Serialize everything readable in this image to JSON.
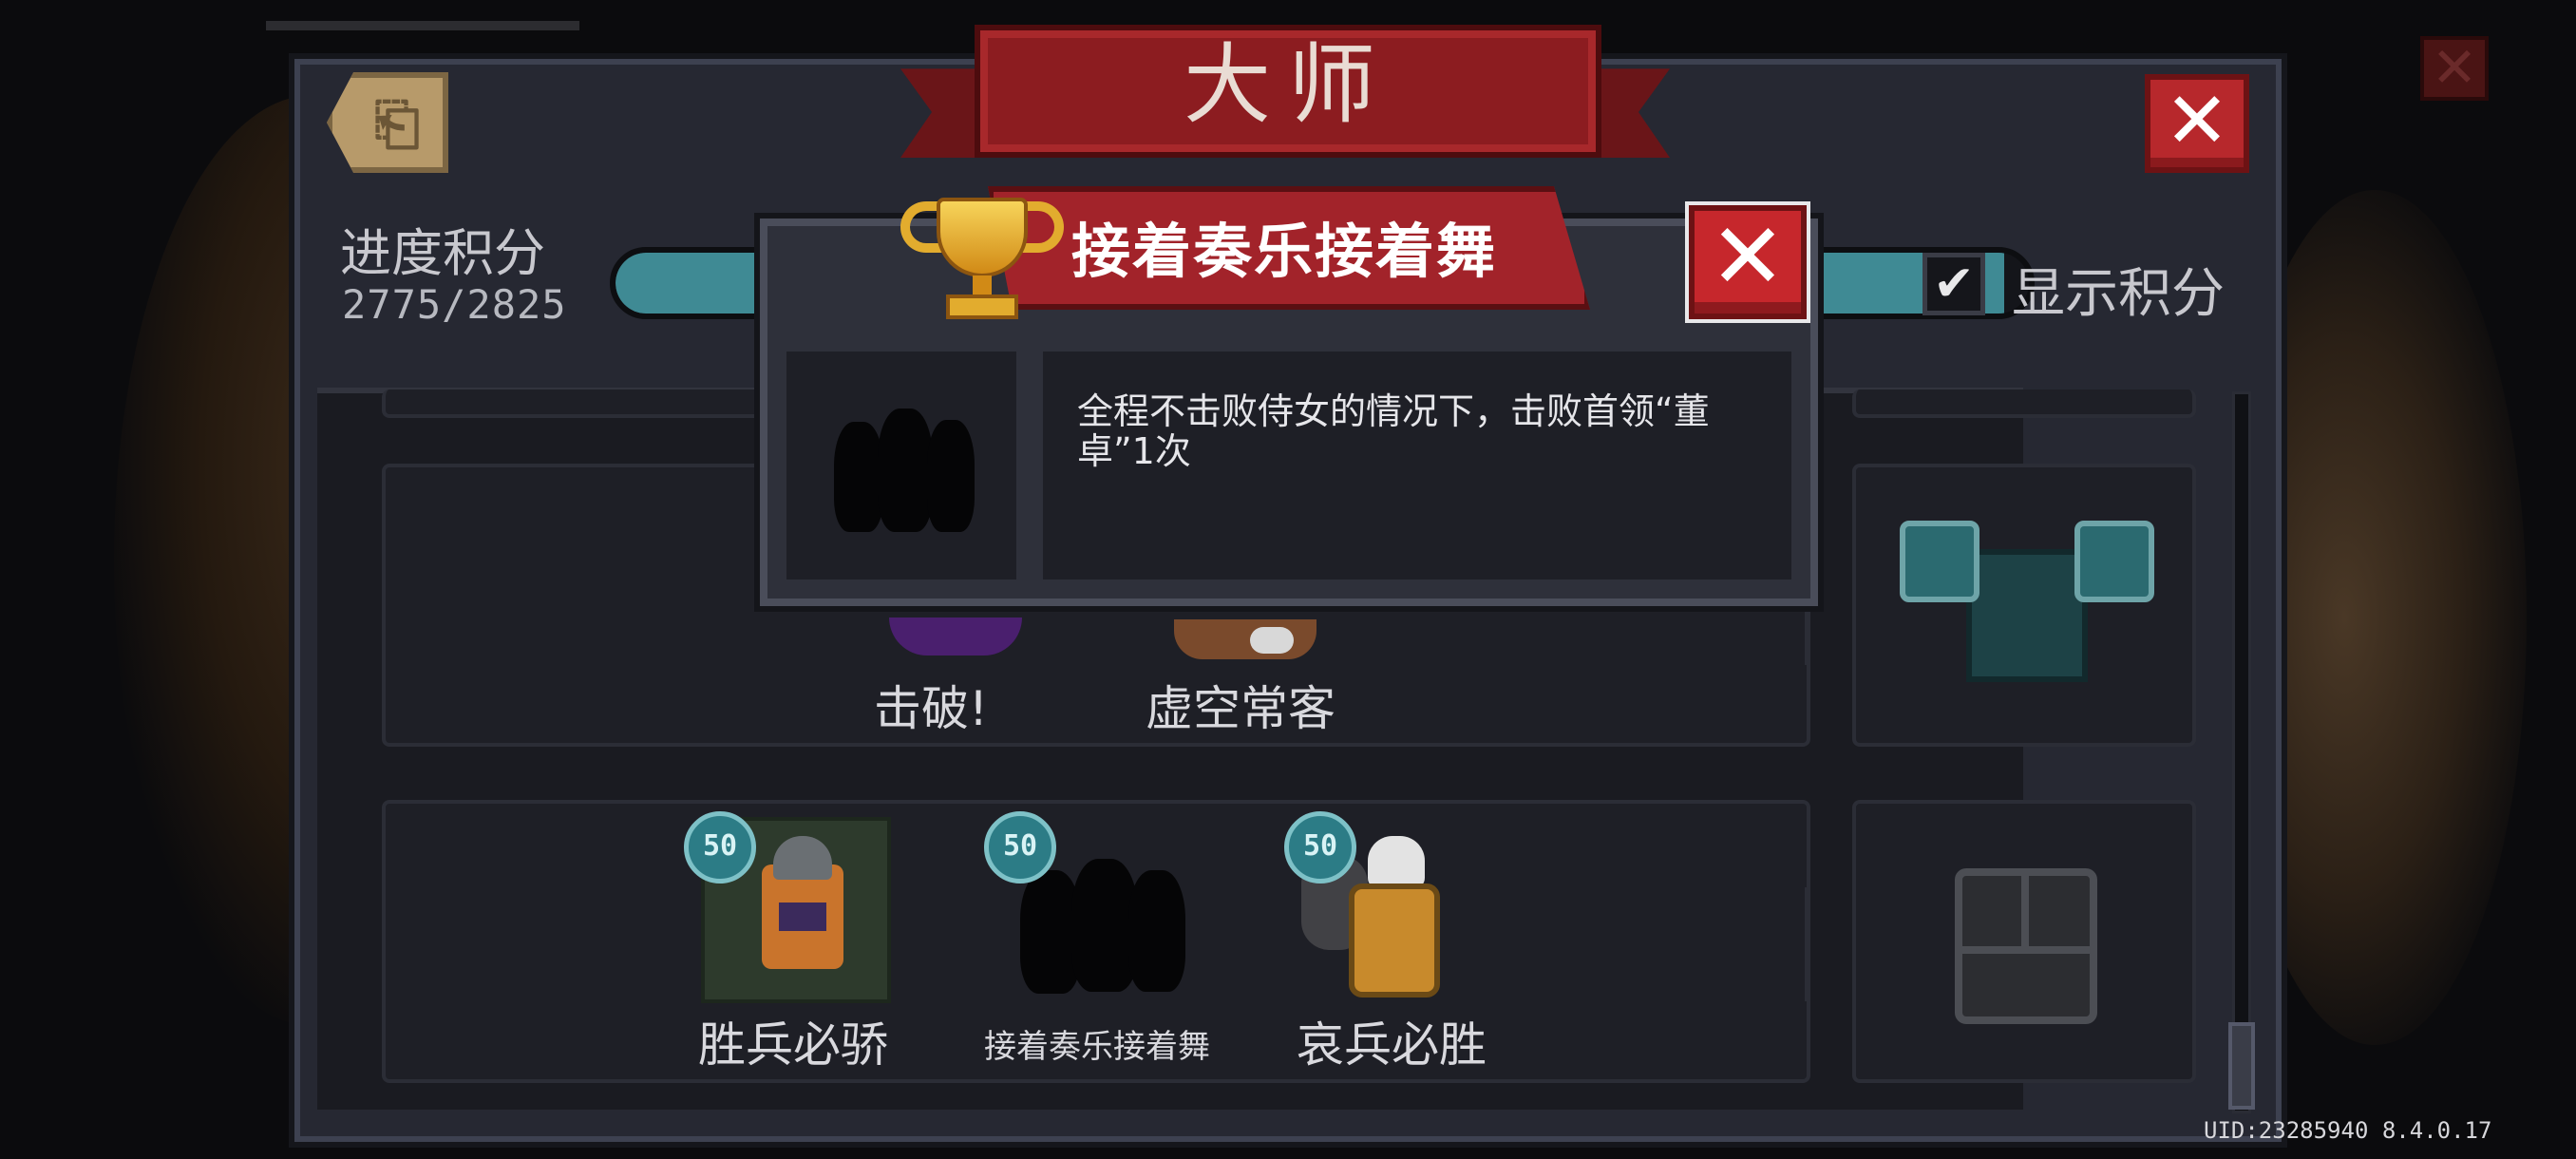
{
  "background": {
    "close_glyph": "✕"
  },
  "panel": {
    "title": "大师",
    "back_glyph": "⎗",
    "close_glyph": "✕"
  },
  "progress": {
    "label": "进度积分",
    "value_text": "2775/2825",
    "current": 2775,
    "total": 2825
  },
  "show_points": {
    "label": "显示积分",
    "checked": true,
    "check_glyph": "✔"
  },
  "rows": [
    {
      "achievements": [
        {
          "name": "击破!"
        },
        {
          "name": "虚空常客"
        }
      ],
      "chest_state": "open"
    },
    {
      "achievements": [
        {
          "name": "胜兵必骄",
          "points": "50",
          "icon": "knight-sprite-icon"
        },
        {
          "name": "接着奏乐接着舞",
          "points": "50",
          "icon": "silhouette-sprite-icon"
        },
        {
          "name": "哀兵必胜",
          "points": "50",
          "icon": "gold-warrior-sprite-icon"
        }
      ],
      "chest_state": "locked"
    }
  ],
  "popup": {
    "title": "接着奏乐接着舞",
    "description": "全程不击败侍女的情况下，击败首领“董卓”1次",
    "close_glyph": "✕",
    "icon": "trophy-icon"
  },
  "footer": {
    "uid_text": "UID:23285940 8.4.0.17"
  },
  "colors": {
    "accent_red": "#a2232a",
    "progress_teal": "#3f8a94",
    "panel": "#262832"
  }
}
